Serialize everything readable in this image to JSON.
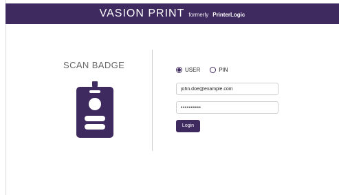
{
  "header": {
    "brand_main": "VASION PRINT",
    "brand_formerly": "formerly",
    "brand_old": "PrinterLogic"
  },
  "badge": {
    "title": "SCAN BADGE",
    "icon": "badge-icon",
    "color": "#3f2a5f"
  },
  "auth": {
    "options": [
      "USER",
      "PIN"
    ],
    "selected": "USER",
    "email_value": "john.doe@example.com",
    "password_value": "••••••••••",
    "login_label": "Login"
  },
  "colors": {
    "accent": "#3f2a5f",
    "divider": "#cfcfcf",
    "title_text": "#666666"
  }
}
